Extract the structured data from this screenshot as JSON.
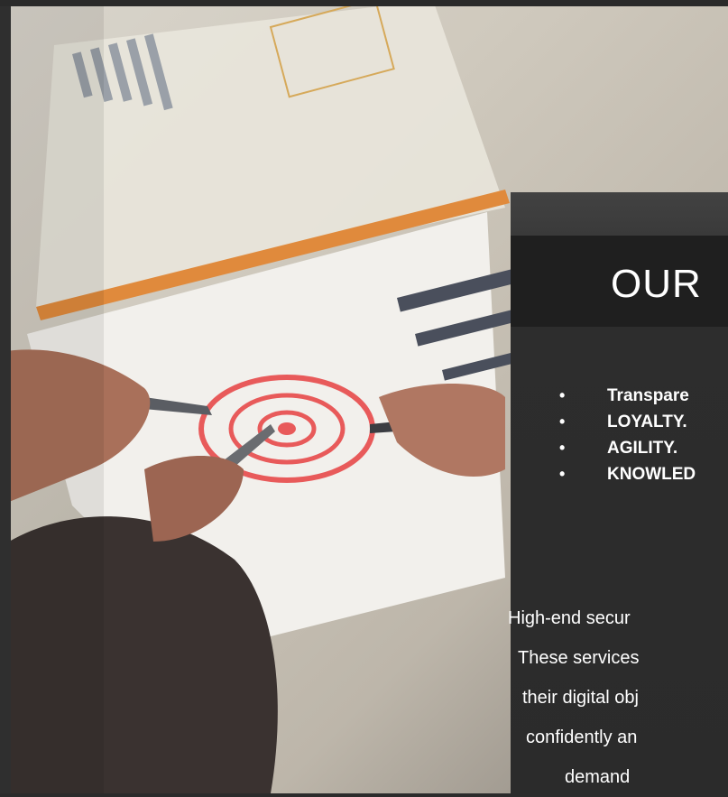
{
  "photo": {
    "alt": "BUSINESS GOALS"
  },
  "section": {
    "title": "OUR",
    "values": [
      "Transpare",
      "LOYALTY.",
      "AGILITY.",
      "KNOWLED"
    ],
    "description_lines": [
      "High-end secur",
      "These services",
      "their digital obj",
      "confidently an",
      "demand"
    ]
  },
  "colors": {
    "background": "#2b2b2b",
    "card": "#2d2d2d",
    "title_bar": "#1f1f1f",
    "text": "#ffffff"
  }
}
